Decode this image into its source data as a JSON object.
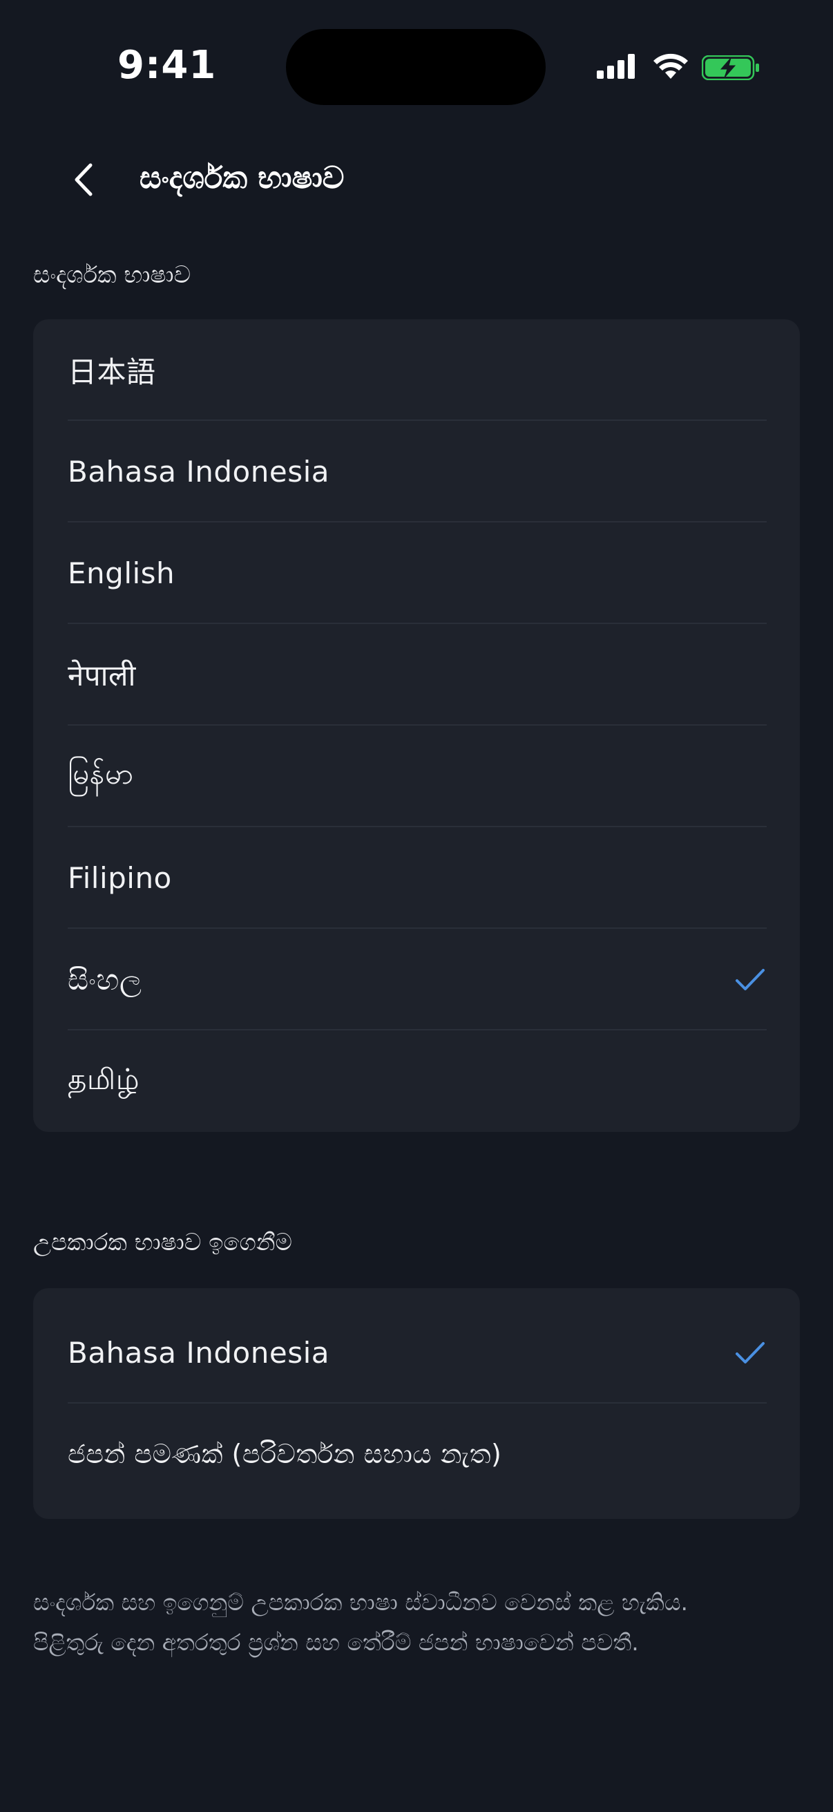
{
  "status_bar": {
    "time": "9:41"
  },
  "nav": {
    "title": "සංදර්ශක භාෂාව",
    "back_icon": "chevron-left-icon"
  },
  "display_language": {
    "header": "සංදර්ශක භාෂාව",
    "items": [
      {
        "label": "日本語",
        "selected": false
      },
      {
        "label": "Bahasa Indonesia",
        "selected": false
      },
      {
        "label": "English",
        "selected": false
      },
      {
        "label": "नेपाली",
        "selected": false
      },
      {
        "label": "မြန်မာ",
        "selected": false
      },
      {
        "label": "Filipino",
        "selected": false
      },
      {
        "label": "සිංහල",
        "selected": true
      },
      {
        "label": "தமிழ்",
        "selected": false
      }
    ]
  },
  "support_language": {
    "header": "උපකාරක භාෂාව ඉගෙනීම",
    "items": [
      {
        "label": "Bahasa Indonesia",
        "selected": true
      },
      {
        "label": "ජපන් පමණක් (පරිවර්තන සහාය නැත)",
        "selected": false
      }
    ]
  },
  "footer": {
    "line1": "සංදර්ශක සහ ඉගෙනුම් උපකාරක භාෂා ස්වාධීනව වෙනස් කළ හැකිය.",
    "line2": "පිළිතුරු දෙන අතරතුර ප්‍රශ්න සහ තේරීම් ජපන් භාෂාවෙන් පවතී."
  },
  "colors": {
    "background": "#141821",
    "card": "#1e222b",
    "accent_check": "#4a90e2",
    "battery_green": "#34c759"
  }
}
